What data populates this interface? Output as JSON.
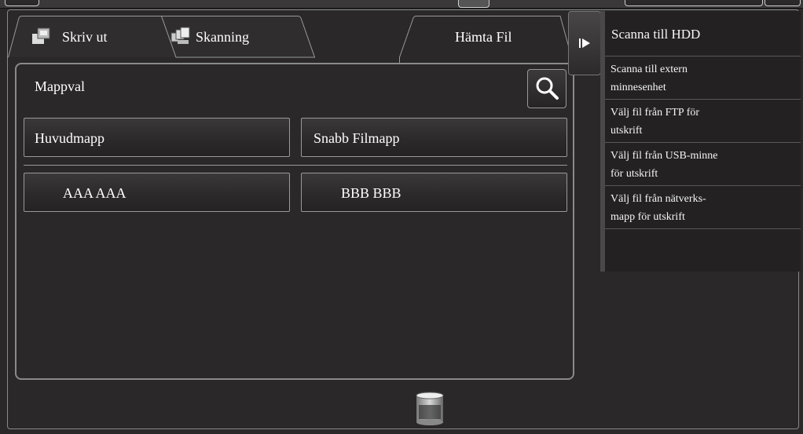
{
  "tabs": {
    "print": {
      "label": "Skriv ut",
      "icon": "print-icon"
    },
    "scan": {
      "label": "Skanning",
      "icon": "scan-icon"
    },
    "retrieve": {
      "label": "Hämta Fil"
    }
  },
  "main": {
    "section_label": "Mappval",
    "search_icon": "search-icon",
    "folders_top": [
      "Huvudmapp",
      "Snabb Filmapp"
    ],
    "folders_user": [
      "AAA AAA",
      "BBB BBB"
    ]
  },
  "sidebar": {
    "expand_icon": "play-arrow-icon",
    "header": "Scanna till HDD",
    "items": [
      {
        "line1": "Scanna till extern",
        "line2": "minnesenhet"
      },
      {
        "line1": "Välj fil från FTP för",
        "line2": "utskrift"
      },
      {
        "line1": "Välj fil från USB-minne",
        "line2": "för utskrift"
      },
      {
        "line1": "Välj fil från nätverks-",
        "line2": "mapp för utskrift"
      }
    ]
  },
  "footer": {
    "icon": "storage-icon"
  },
  "colors": {
    "background": "#2a2828",
    "border": "#8a8a8a",
    "text": "#ffffff"
  }
}
